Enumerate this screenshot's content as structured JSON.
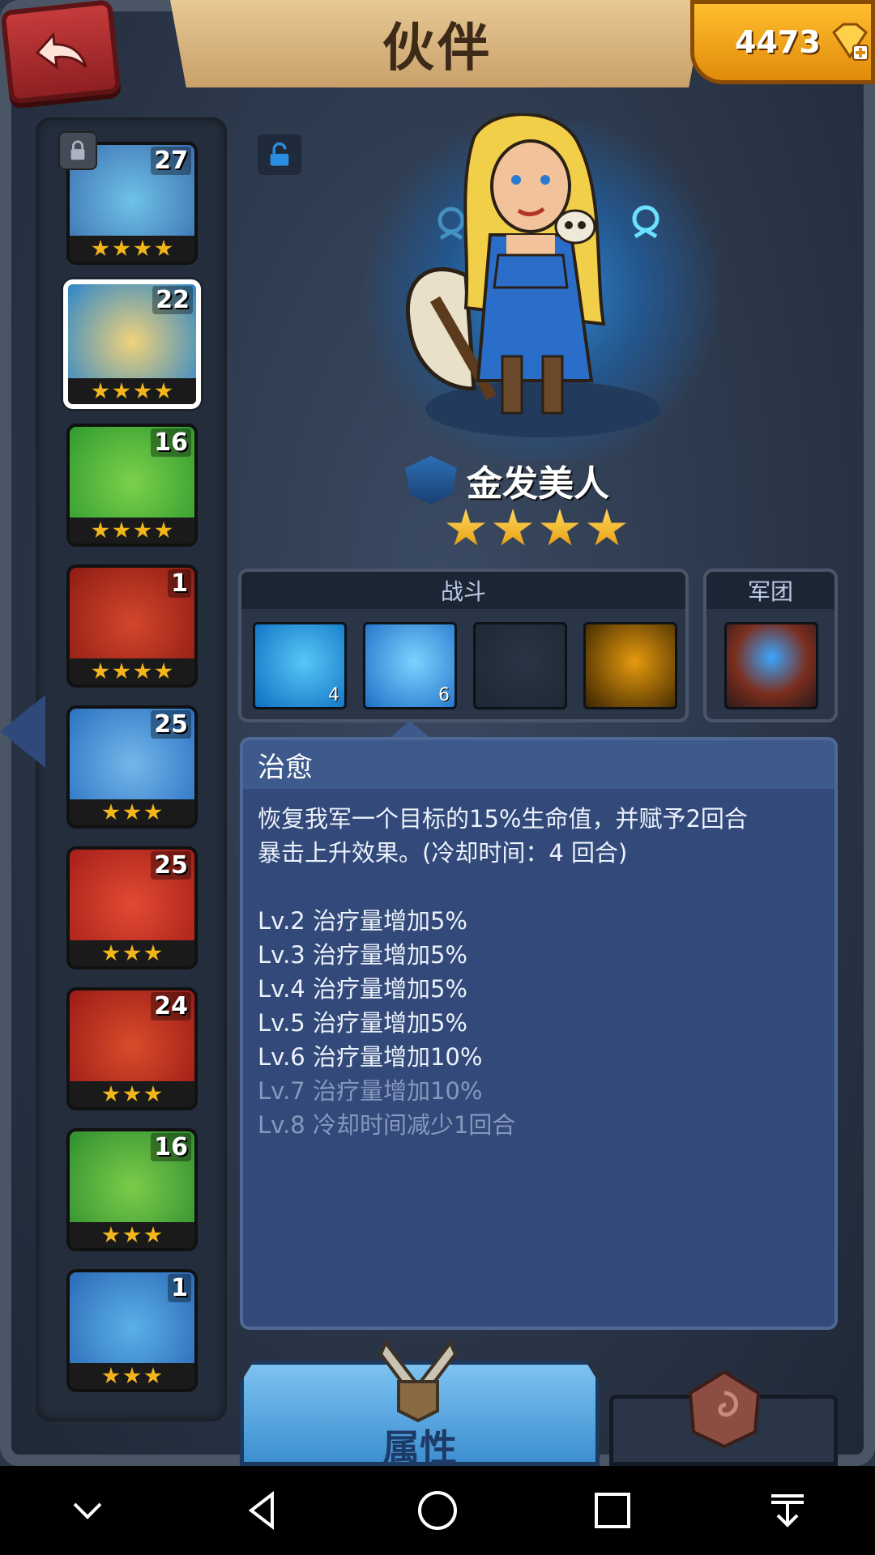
{
  "header": {
    "title": "伙伴",
    "gem_count": "4473",
    "back_icon": "back-arrow-icon",
    "gem_icon": "diamond-plus-icon"
  },
  "hero_list": [
    {
      "level": "27",
      "stars": 4,
      "locked": true,
      "palette": [
        "#3c6fb0",
        "#6ec2e8"
      ]
    },
    {
      "level": "22",
      "stars": 4,
      "selected": true,
      "palette": [
        "#2c86c9",
        "#f0d27a"
      ]
    },
    {
      "level": "16",
      "stars": 4,
      "palette": [
        "#2f9a2f",
        "#7cd14b"
      ]
    },
    {
      "level": "1",
      "stars": 4,
      "palette": [
        "#8e1c14",
        "#d3462c"
      ]
    },
    {
      "level": "25",
      "stars": 3,
      "palette": [
        "#2a72c2",
        "#74b8ea"
      ]
    },
    {
      "level": "25",
      "stars": 3,
      "palette": [
        "#a61f1a",
        "#e24a32"
      ]
    },
    {
      "level": "24",
      "stars": 3,
      "palette": [
        "#9c1b18",
        "#d94c2a"
      ]
    },
    {
      "level": "16",
      "stars": 3,
      "palette": [
        "#2f8f2f",
        "#7ccc4a"
      ]
    },
    {
      "level": "1",
      "stars": 3,
      "palette": [
        "#2b6ab5",
        "#5bb0e8"
      ]
    }
  ],
  "hero": {
    "name": "金发美人",
    "stars": 4
  },
  "battle_panel": {
    "label": "战斗",
    "skills": [
      {
        "name": "axe-skill-icon",
        "level": "4",
        "bg": [
          "#0d6fc3",
          "#57c7f5"
        ]
      },
      {
        "name": "heal-hand-skill-icon",
        "level": "6",
        "bg": [
          "#1f6fc7",
          "#7bd3ff"
        ]
      },
      {
        "name": "locked-rune-skill-icon",
        "level": "",
        "bg": [
          "#1e2734",
          "#2a3444"
        ]
      },
      {
        "name": "helmet-skill-icon",
        "level": "",
        "bg": [
          "#3a2400",
          "#e59a0e"
        ]
      }
    ]
  },
  "legion_panel": {
    "label": "军团",
    "skill": {
      "name": "shaman-skill-icon",
      "bg": [
        "#2c1a1a",
        "#7a2e1e"
      ]
    }
  },
  "skill_detail": {
    "title": "治愈",
    "desc_line1": "恢复我军一个目标的15%生命值，并赋予2回合",
    "desc_line2": "暴击上升效果。(冷却时间：4 回合)",
    "levels": [
      {
        "text": "Lv.2 治疗量增加5%",
        "unlocked": true
      },
      {
        "text": "Lv.3 治疗量增加5%",
        "unlocked": true
      },
      {
        "text": "Lv.4 治疗量增加5%",
        "unlocked": true
      },
      {
        "text": "Lv.5 治疗量增加5%",
        "unlocked": true
      },
      {
        "text": "Lv.6 治疗量增加10%",
        "unlocked": true
      },
      {
        "text": "Lv.7 治疗量增加10%",
        "unlocked": false
      },
      {
        "text": "Lv.8 冷却时间减少1回合",
        "unlocked": false
      }
    ]
  },
  "tabs": {
    "attributes_label": "属性",
    "attributes_icon": "crossed-swords-icon",
    "other_icon": "rune-stone-icon"
  },
  "navbar": [
    "collapse-icon",
    "back-triangle-icon",
    "home-circle-icon",
    "recents-square-icon",
    "download-icon"
  ]
}
